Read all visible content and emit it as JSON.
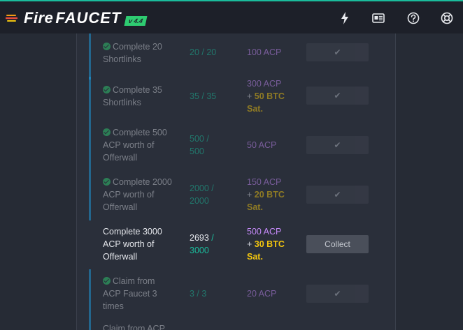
{
  "brand": {
    "fire": "Fire",
    "faucet": "FAUCET",
    "version": "v 4.4"
  },
  "topbar": {
    "icons": [
      "lightning-icon",
      "news-icon",
      "help-icon",
      "support-icon"
    ]
  },
  "tasks": [
    {
      "task": "Complete 20 Shortlinks",
      "done": true,
      "progress_current": "20",
      "progress_total": "20",
      "reward_acp": "100 ACP",
      "reward_btc": "",
      "button": "✔"
    },
    {
      "task": "Complete 35 Shortlinks",
      "done": true,
      "progress_current": "35",
      "progress_total": "35",
      "reward_acp": "300 ACP",
      "reward_btc": "50 BTC Sat.",
      "button": "✔"
    },
    {
      "task": "Complete 500 ACP worth of Offerwall",
      "done": true,
      "progress_current": "500",
      "progress_total": "500",
      "reward_acp": "50 ACP",
      "reward_btc": "",
      "button": "✔"
    },
    {
      "task": "Complete 2000 ACP worth of Offerwall",
      "done": true,
      "progress_current": "2000",
      "progress_total": "2000",
      "reward_acp": "150 ACP",
      "reward_btc": "20 BTC Sat.",
      "button": "✔"
    },
    {
      "task": "Complete 3000 ACP worth of Offerwall",
      "done": false,
      "progress_current": "2693",
      "progress_total": "3000",
      "reward_acp": "500 ACP",
      "reward_btc": "30 BTC Sat.",
      "button": "Collect"
    },
    {
      "task": "Claim from ACP Faucet 3 times",
      "done": true,
      "progress_current": "3",
      "progress_total": "3",
      "reward_acp": "20 ACP",
      "reward_btc": "",
      "button": "✔"
    },
    {
      "task": "Claim from ACP",
      "done": true,
      "progress_current": "",
      "progress_total": "",
      "reward_acp": "",
      "reward_btc": "",
      "button": ""
    }
  ],
  "colors": {
    "accent_teal": "#1abc9c",
    "accent_blue": "#1e9ee0",
    "acp_purple": "#c58af9",
    "btc_gold": "#f1c40f"
  }
}
